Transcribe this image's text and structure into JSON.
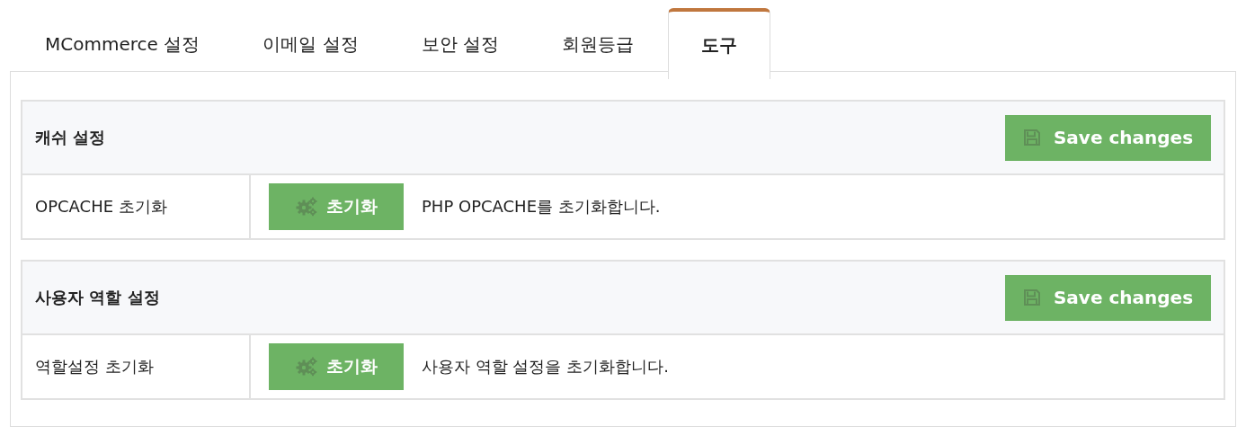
{
  "tabs": [
    {
      "label": "MCommerce 설정",
      "selected": false
    },
    {
      "label": "이메일 설정",
      "selected": false
    },
    {
      "label": "보안 설정",
      "selected": false
    },
    {
      "label": "회원등급",
      "selected": false
    },
    {
      "label": "도구",
      "selected": true
    }
  ],
  "sections": [
    {
      "title": "캐쉬 설정",
      "save_button": "Save changes",
      "rows": [
        {
          "label": "OPCACHE 초기화",
          "button": "초기화",
          "description": "PHP OPCACHE를 초기화합니다."
        }
      ]
    },
    {
      "title": "사용자 역할 설정",
      "save_button": "Save changes",
      "rows": [
        {
          "label": "역할설정 초기화",
          "button": "초기화",
          "description": "사용자 역할 설정을 초기화합니다."
        }
      ]
    }
  ]
}
